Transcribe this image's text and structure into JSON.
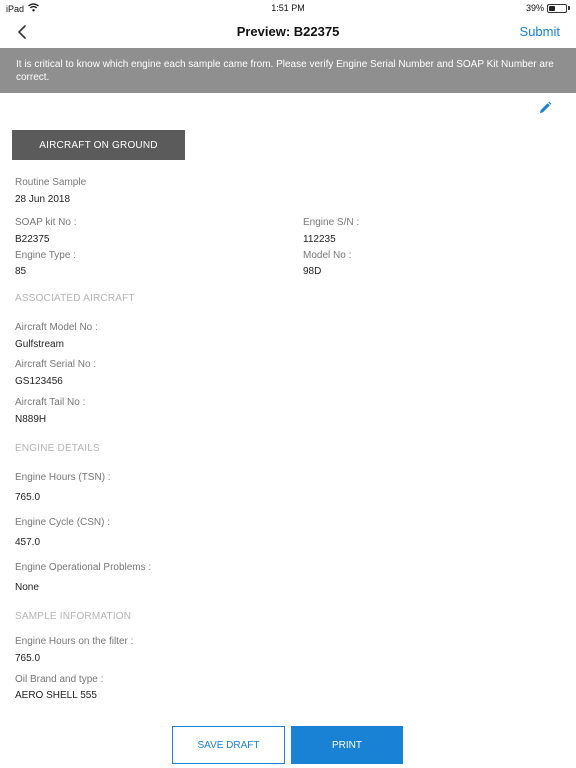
{
  "status_bar": {
    "device": "iPad",
    "time": "1:51 PM",
    "battery_text": "39%",
    "battery_level": 0.39,
    "wifi_icon": "wifi-icon"
  },
  "nav": {
    "back_icon": "chevron-left-icon",
    "title": "Preview: B22375",
    "submit_label": "Submit"
  },
  "banner": {
    "message": "It is critical to know which engine each sample came from.  Please verify Engine Serial Number and SOAP Kit Number are correct."
  },
  "edit_icon": "pencil-icon",
  "aog_label": "AIRCRAFT ON GROUND",
  "sample": {
    "type_label": "Routine Sample",
    "date": "28 Jun 2018",
    "soap_kit_label": "SOAP kit No :",
    "soap_kit_value": "B22375",
    "engine_sn_label": "Engine S/N :",
    "engine_sn_value": "112235",
    "engine_type_label": "Engine Type :",
    "engine_type_value": "85",
    "model_label": "Model No :",
    "model_value": "98D"
  },
  "associated_aircraft": {
    "heading": "ASSOCIATED AIRCRAFT",
    "model_label": "Aircraft Model No :",
    "model_value": "Gulfstream",
    "serial_label": "Aircraft Serial No :",
    "serial_value": "GS123456",
    "tail_label": "Aircraft Tail No :",
    "tail_value": "N889H"
  },
  "engine_details": {
    "heading": "ENGINE DETAILS",
    "hours_label": "Engine Hours (TSN) :",
    "hours_value": "765.0",
    "cycle_label": "Engine Cycle (CSN) :",
    "cycle_value": "457.0",
    "problems_label": "Engine Operational Problems :",
    "problems_value": "None"
  },
  "sample_information": {
    "heading": "SAMPLE INFORMATION",
    "filter_hours_label": "Engine Hours on the filter :",
    "filter_hours_value": "765.0",
    "oil_label": "Oil Brand and type :",
    "oil_value": "AERO SHELL 555"
  },
  "actions": {
    "save_draft_label": "SAVE DRAFT",
    "print_label": "PRINT"
  },
  "colors": {
    "accent": "#1a82d4",
    "banner_bg": "#8f8f8f",
    "aog_bg": "#5b5b5b",
    "section_heading": "#b5b5b5"
  }
}
